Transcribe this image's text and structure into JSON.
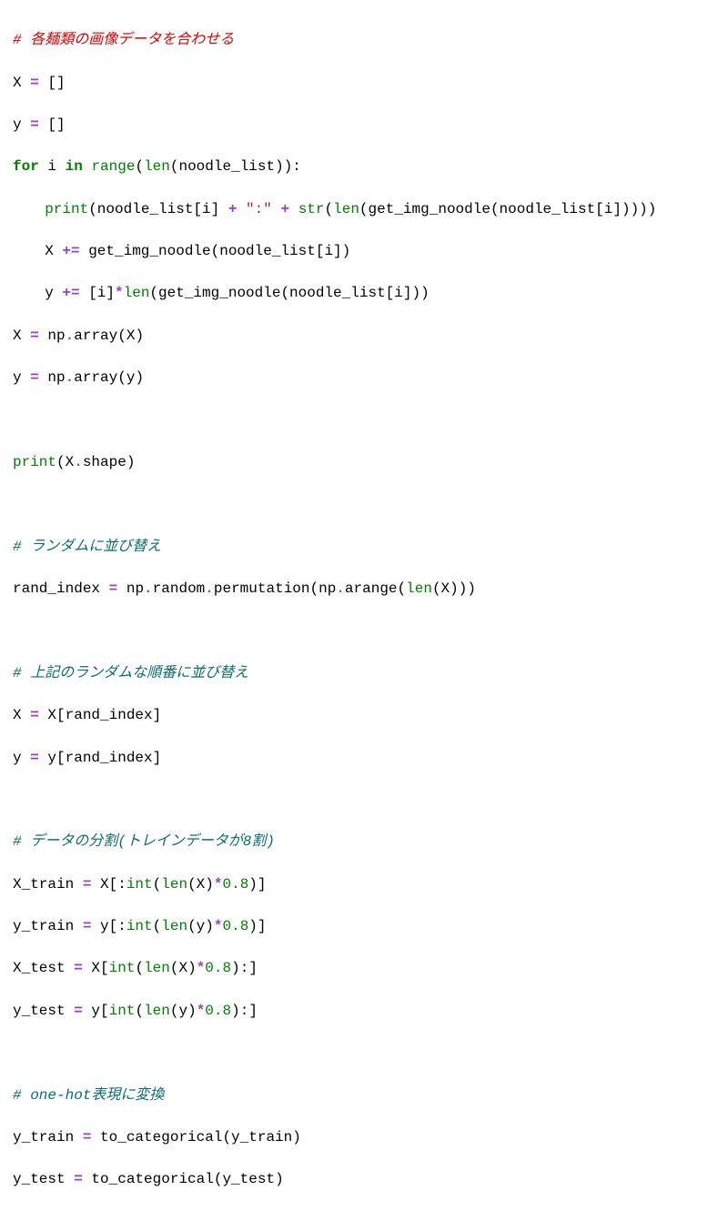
{
  "code": {
    "c1": "# 各麺類の画像データを合わせる",
    "l2a": "X ",
    "l2b": "=",
    "l2c": " []",
    "l3a": "y ",
    "l3b": "=",
    "l3c": " []",
    "l4a": "for",
    "l4b": " i ",
    "l4c": "in",
    "l4d": " ",
    "l4e": "range",
    "l4f": "(",
    "l4g": "len",
    "l4h": "(noodle_list)):",
    "l5a": "print",
    "l5b": "(noodle_list[i] ",
    "l5c": "+",
    "l5d": " ",
    "l5e": "\":\"",
    "l5f": " ",
    "l5g": "+",
    "l5h": " ",
    "l5i": "str",
    "l5j": "(",
    "l5k": "len",
    "l5l": "(get_img_noodle(noodle_list[i]))))",
    "l6a": "X ",
    "l6b": "+=",
    "l6c": " get_img_noodle(noodle_list[i])",
    "l7a": "y ",
    "l7b": "+=",
    "l7c": " [i]",
    "l7d": "*",
    "l7e": "len",
    "l7f": "(get_img_noodle(noodle_list[i]))",
    "l8a": "X ",
    "l8b": "=",
    "l8c": " np",
    "l8d": ".",
    "l8e": "array(X)",
    "l9a": "y ",
    "l9b": "=",
    "l9c": " np",
    "l9d": ".",
    "l9e": "array(y)",
    "l10blank": " ",
    "l11a": "print",
    "l11b": "(X",
    "l11c": ".",
    "l11d": "shape)",
    "l12blank": " ",
    "c2": "# ランダムに並び替え",
    "l14a": "rand_index ",
    "l14b": "=",
    "l14c": " np",
    "l14d": ".",
    "l14e": "random",
    "l14f": ".",
    "l14g": "permutation(np",
    "l14h": ".",
    "l14i": "arange(",
    "l14j": "len",
    "l14k": "(X)))",
    "l15blank": " ",
    "c3": "# 上記のランダムな順番に並び替え",
    "l17a": "X ",
    "l17b": "=",
    "l17c": " X[rand_index]",
    "l18a": "y ",
    "l18b": "=",
    "l18c": " y[rand_index]",
    "l19blank": " ",
    "c4": "# データの分割(トレインデータが8割)",
    "l21a": "X_train ",
    "l21b": "=",
    "l21c": " X[:",
    "l21d": "int",
    "l21e": "(",
    "l21f": "len",
    "l21g": "(X)",
    "l21h": "*",
    "l21i": "0.8",
    "l21j": ")]",
    "l22a": "y_train ",
    "l22b": "=",
    "l22c": " y[:",
    "l22d": "int",
    "l22e": "(",
    "l22f": "len",
    "l22g": "(y)",
    "l22h": "*",
    "l22i": "0.8",
    "l22j": ")]",
    "l23a": "X_test ",
    "l23b": "=",
    "l23c": " X[",
    "l23d": "int",
    "l23e": "(",
    "l23f": "len",
    "l23g": "(X)",
    "l23h": "*",
    "l23i": "0.8",
    "l23j": "):]",
    "l24a": "y_test ",
    "l24b": "=",
    "l24c": " y[",
    "l24d": "int",
    "l24e": "(",
    "l24f": "len",
    "l24g": "(y)",
    "l24h": "*",
    "l24i": "0.8",
    "l24j": "):]",
    "l25blank": " ",
    "c5": "# one-hot表現に変換",
    "l27a": "y_train ",
    "l27b": "=",
    "l27c": " to_categorical(y_train)",
    "l28a": "y_test ",
    "l28b": "=",
    "l28c": " to_categorical(y_test)"
  }
}
